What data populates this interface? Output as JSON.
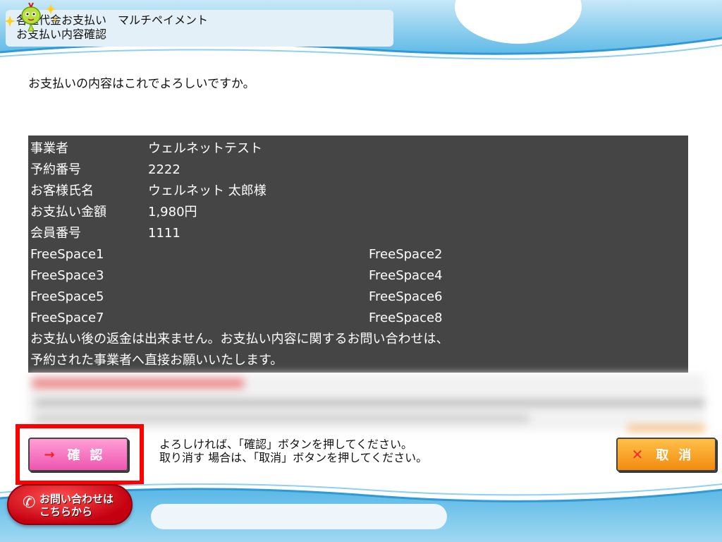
{
  "header": {
    "title_line1": "各種代金お支払い　マルチペイメント",
    "title_line2": "お支払い内容確認"
  },
  "question": "お支払いの内容はこれでよろしいですか。",
  "details": {
    "rows": [
      {
        "label": "事業者",
        "value": "ウェルネットテスト"
      },
      {
        "label": "予約番号",
        "value": "2222"
      },
      {
        "label": "お客様氏名",
        "value": "ウェルネット 太郎様"
      },
      {
        "label": "お支払い金額",
        "value": "1,980円"
      },
      {
        "label": "会員番号",
        "value": "1111"
      }
    ],
    "free_spaces": [
      [
        "FreeSpace1",
        "FreeSpace2"
      ],
      [
        "FreeSpace3",
        "FreeSpace4"
      ],
      [
        "FreeSpace5",
        "FreeSpace6"
      ],
      [
        "FreeSpace7",
        "FreeSpace8"
      ]
    ],
    "note_line1": "お支払い後の返金は出来ません。お支払い内容に関するお問い合わせは、",
    "note_line2": "予約された事業者へ直接お願いいたします。"
  },
  "actions": {
    "confirm_label": "確認",
    "cancel_label": "取消",
    "instruction_line1": "よろしければ、「確認」ボタンを押してください。",
    "instruction_line2": "取り消す 場合は、「取消」ボタンを押してください。"
  },
  "footer": {
    "contact_line1": "お問い合わせは",
    "contact_line2": "こちらから"
  },
  "icons": {
    "confirm": "arrow-right-icon",
    "cancel": "x-icon",
    "contact": "phone-icon",
    "mascot": "mascot-icon"
  },
  "colors": {
    "panel_bg": "#454545",
    "confirm_button": "#ee55b0",
    "cancel_button": "#f28c10",
    "highlight_frame": "#ff0000",
    "contact_button": "#c40010",
    "wave_blue": "#3aa8dc"
  }
}
